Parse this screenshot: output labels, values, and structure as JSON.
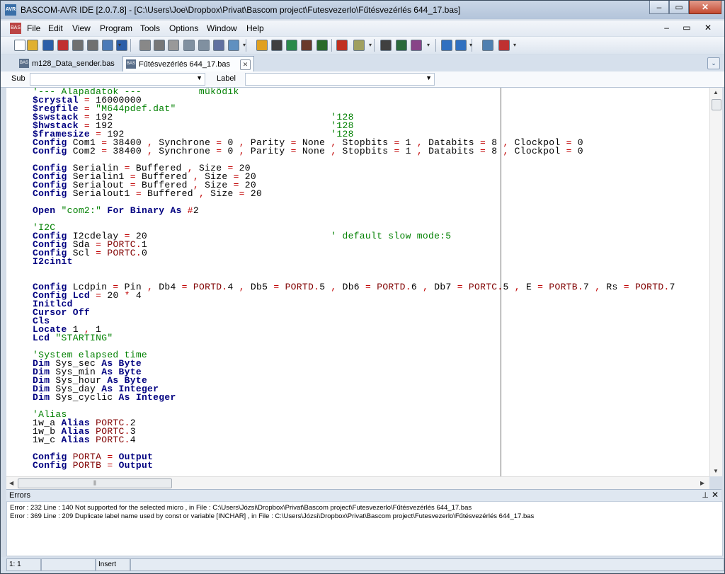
{
  "window": {
    "title": "BASCOM-AVR IDE [2.0.7.8] - [C:\\Users\\Joe\\Dropbox\\Privat\\Bascom project\\Futesvezerlo\\Fűtésvezérlés 644_17.bas]",
    "min": "‒",
    "max": "▭",
    "close": "✕"
  },
  "menu": {
    "items": [
      "File",
      "Edit",
      "View",
      "Program",
      "Tools",
      "Options",
      "Window",
      "Help"
    ],
    "mdi": "‒ ▭ ✕"
  },
  "toolbar": {
    "icons": [
      "new-file-icon",
      "open-file-icon",
      "save-icon",
      "save-all-icon",
      "print-icon",
      "print-preview-icon",
      "zoom-icon",
      "export-icon",
      "cut-icon",
      "copy-icon",
      "paste-icon",
      "indent-icon",
      "outdent-icon",
      "find-icon",
      "replace-icon",
      "bookmark-icon",
      "check-icon",
      "compile-icon",
      "chip-icon",
      "program-chip-icon",
      "simulate-icon",
      "run-icon",
      "terminal-icon",
      "lcd-icon",
      "graphic-icon",
      "help-icon",
      "info-icon",
      "search-help-icon",
      "pdf-icon"
    ]
  },
  "tabs": [
    {
      "label": "m128_Data_sender.bas",
      "active": false
    },
    {
      "label": "Fűtésvezérlés 644_17.bas",
      "active": true
    }
  ],
  "subbar": {
    "sub_label": "Sub",
    "label_label": "Label",
    "sub_value": "",
    "label_value": ""
  },
  "code": [
    "'--- Alapadatok ---          működik",
    "$crystal = 16000000",
    "$regfile = \"M644pdef.dat\"",
    "$swstack = 192                                      '128",
    "$hwstack = 192                                      '128",
    "$framesize = 192                                    '128",
    "Config Com1 = 38400 , Synchrone = 0 , Parity = None , Stopbits = 1 , Databits = 8 , Clockpol = 0",
    "Config Com2 = 38400 , Synchrone = 0 , Parity = None , Stopbits = 1 , Databits = 8 , Clockpol = 0",
    "",
    "Config Serialin = Buffered , Size = 20",
    "Config Serialin1 = Buffered , Size = 20",
    "Config Serialout = Buffered , Size = 20",
    "Config Serialout1 = Buffered , Size = 20",
    "",
    "Open \"com2:\" For Binary As #2",
    "",
    "'I2C",
    "Config I2cdelay = 20                                ' default slow mode:5",
    "Config Sda = PORTC.1",
    "Config Scl = PORTC.0",
    "I2cinit",
    "",
    "",
    "Config Lcdpin = Pin , Db4 = PORTD.4 , Db5 = PORTD.5 , Db6 = PORTD.6 , Db7 = PORTC.5 , E = PORTB.7 , Rs = PORTD.7",
    "Config Lcd = 20 * 4",
    "Initlcd",
    "Cursor Off",
    "Cls",
    "Locate 1 , 1",
    "Lcd \"STARTING\"",
    "",
    "'System elapsed time",
    "Dim Sys_sec As Byte",
    "Dim Sys_min As Byte",
    "Dim Sys_hour As Byte",
    "Dim Sys_day As Integer",
    "Dim Sys_cyclic As Integer",
    "",
    "'Alias",
    "1w_a Alias PORTC.2",
    "1w_b Alias PORTC.3",
    "1w_c Alias PORTC.4",
    "",
    "Config PORTA = Output",
    "Config PORTB = Output"
  ],
  "errors": {
    "title": "Errors",
    "pin": "📌",
    "close": "✕",
    "lines": [
      "Error : 232   Line :     140   Not supported for the selected micro  , in File : C:\\Users\\Józsi\\Dropbox\\Privat\\Bascom project\\Futesvezerlo\\Fűtésvezérlés 644_17.bas",
      "Error : 369   Line :     209   Duplicate label name used by const or variable [INCHAR]  , in File : C:\\Users\\Józsi\\Dropbox\\Privat\\Bascom project\\Futesvezerlo\\Fűtésvezérlés 644_17.bas"
    ]
  },
  "status": {
    "position": "1: 1",
    "mode": "Insert"
  }
}
